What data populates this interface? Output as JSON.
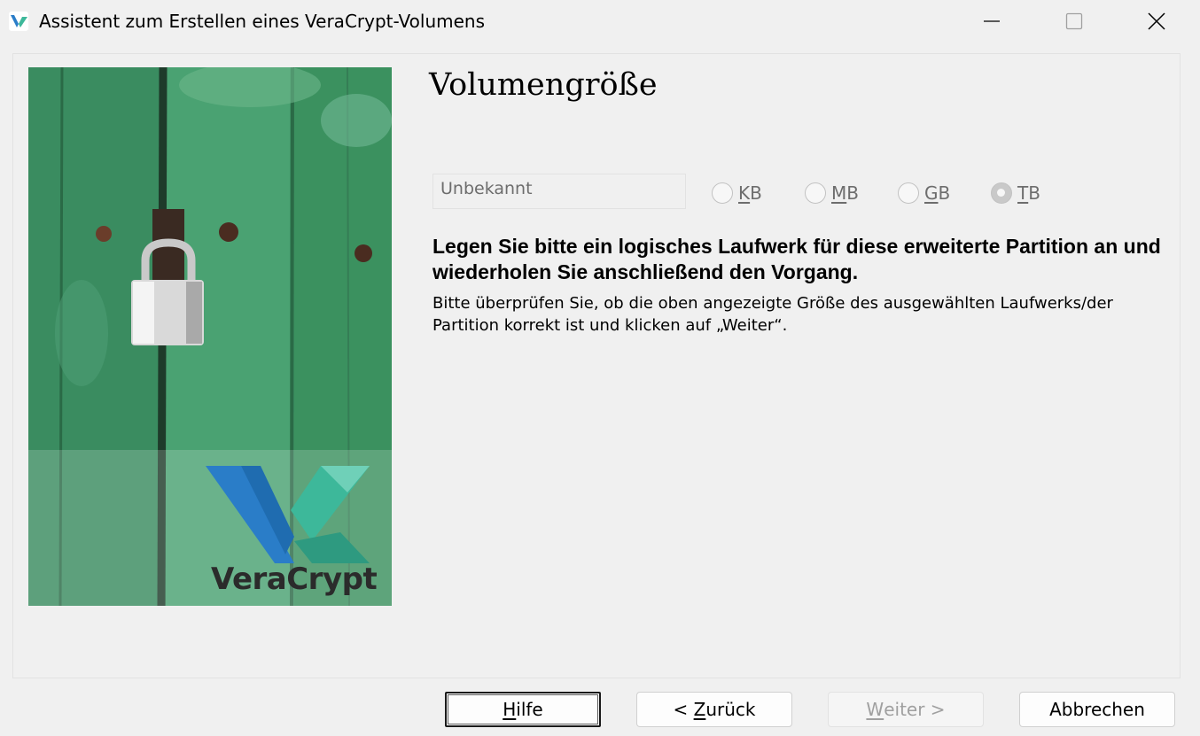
{
  "window": {
    "title": "Assistent zum Erstellen eines VeraCrypt-Volumens",
    "app_icon_text": "VC"
  },
  "page": {
    "heading": "Volumengröße",
    "size_field_value": "Unbekannt",
    "units": [
      {
        "key": "K",
        "rest": "B",
        "selected": false
      },
      {
        "key": "M",
        "rest": "B",
        "selected": false
      },
      {
        "key": "G",
        "rest": "B",
        "selected": false
      },
      {
        "key": "T",
        "rest": "B",
        "selected": true
      }
    ],
    "bold_message": "Legen Sie bitte ein logisches Laufwerk für diese erweiterte Partition an und wiederholen Sie anschließend den Vorgang.",
    "info_message": "Bitte überprüfen Sie, ob die oben angezeigte Größe des ausgewählten Laufwerks/der Partition korrekt ist und klicken auf „Weiter“."
  },
  "side_image": {
    "brand_text": "VeraCrypt"
  },
  "buttons": {
    "help_key": "H",
    "help_rest": "ilfe",
    "back_prefix": "< ",
    "back_key": "Z",
    "back_rest": "urück",
    "next_key": "W",
    "next_rest": "eiter >",
    "cancel": "Abbrechen"
  },
  "colors": {
    "window_bg": "#f0f0f0",
    "door_green": "#3f9466",
    "logo_blue": "#2a7dc8",
    "logo_teal": "#3db89a",
    "disabled_text": "#6d6d6d"
  }
}
